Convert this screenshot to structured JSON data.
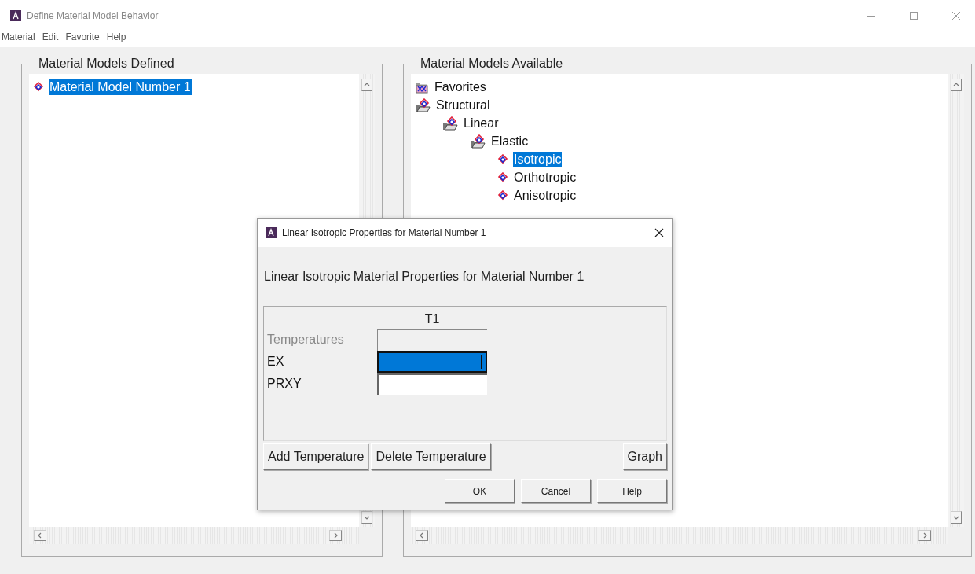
{
  "window": {
    "title": "Define Material Model Behavior"
  },
  "menu": [
    {
      "label": "Material"
    },
    {
      "label": "Edit"
    },
    {
      "label": "Favorite"
    },
    {
      "label": "Help"
    }
  ],
  "defined": {
    "title": "Material Models Defined",
    "items": [
      {
        "label": "Material Model Number 1",
        "kind": "material",
        "selected": true
      }
    ]
  },
  "available": {
    "title": "Material Models Available",
    "tree": [
      {
        "label": "Favorites",
        "kind": "favorites",
        "selected": false
      },
      {
        "label": "Structural",
        "kind": "folder",
        "selected": false,
        "children": [
          {
            "label": "Linear",
            "kind": "folder",
            "selected": false,
            "children": [
              {
                "label": "Elastic",
                "kind": "folder",
                "selected": false,
                "children": [
                  {
                    "label": "Isotropic",
                    "kind": "material",
                    "selected": true
                  },
                  {
                    "label": "Orthotropic",
                    "kind": "material",
                    "selected": false
                  },
                  {
                    "label": "Anisotropic",
                    "kind": "material",
                    "selected": false
                  }
                ]
              }
            ]
          }
        ]
      }
    ]
  },
  "dialog": {
    "title": "Linear Isotropic Properties for Material Number 1",
    "heading": "Linear Isotropic Material Properties for Material Number 1",
    "column": "T1",
    "rows": [
      {
        "label": "Temperatures",
        "disabled": true,
        "selected": false
      },
      {
        "label": "EX",
        "disabled": false,
        "selected": true
      },
      {
        "label": "PRXY",
        "disabled": false,
        "selected": false
      }
    ],
    "actions": [
      {
        "label": "Add Temperature"
      },
      {
        "label": "Delete Temperature"
      }
    ],
    "graph_button": {
      "label": "Graph"
    },
    "buttons": [
      {
        "label": "OK"
      },
      {
        "label": "Cancel"
      },
      {
        "label": "Help"
      }
    ]
  }
}
